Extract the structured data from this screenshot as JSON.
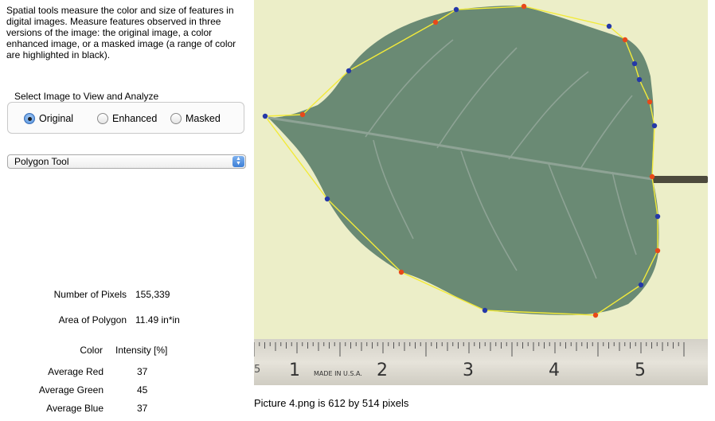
{
  "intro_text": "Spatial tools measure the color and size of features in digital images.  Measure features observed in three versions of the image: the original image, a color enhanced image, or a masked image (a range of color are highlighted in black).",
  "image_select": {
    "title": "Select Image to View and Analyze",
    "options": [
      "Original",
      "Enhanced",
      "Masked"
    ],
    "selected": "Original"
  },
  "tool_select": {
    "value": "Polygon Tool"
  },
  "results": {
    "pixels_label": "Number of Pixels",
    "pixels_value": "155,339",
    "area_label": "Area of Polygon",
    "area_value": "11.49 in*in",
    "color_header": "Color",
    "intensity_header": "Intensity [%]",
    "rows": [
      {
        "label": "Average Red",
        "value": "37"
      },
      {
        "label": "Average Green",
        "value": "45"
      },
      {
        "label": "Average Blue",
        "value": "37"
      }
    ]
  },
  "ruler": {
    "numbers": [
      "1",
      "2",
      "3",
      "4",
      "5"
    ],
    "brand": "MADE IN U.S.A."
  },
  "caption": "Picture 4.png is 612 by 514 pixels",
  "colors": {
    "photo_background": "#eceec8",
    "leaf": "#6a8a74",
    "polygon_line": "#f2ea3a",
    "vertex_red": "#e8481a",
    "vertex_blue": "#2538a8"
  }
}
